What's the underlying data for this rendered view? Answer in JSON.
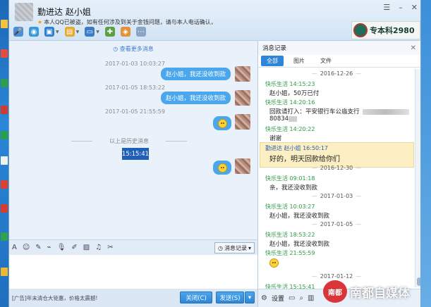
{
  "window": {
    "contact_name": "勤进达 赵小姐",
    "notice": "本人QQ已被盗，如有任何涉及到关于金钱问题，请与本人电话确认，",
    "brand": "专本科2980"
  },
  "chat": {
    "more_messages": "查看更多消息",
    "history_divider": "以上是历史消息",
    "messages": [
      {
        "time": "2017-01-03 10:03:27",
        "text": "赵小姐，我还没收到款"
      },
      {
        "time": "2017-01-05 18:53:22",
        "text": "赵小姐，我还没收到款"
      },
      {
        "time": "2017-01-05 21:55:59",
        "text": ""
      }
    ],
    "current_time": "15:15:41"
  },
  "input": {
    "record_button": "消息记录",
    "ad": "[广告]年末清仓大钜惠，价格太震撼!",
    "close_button": "关闭(C)",
    "send_button": "发送(S)"
  },
  "record": {
    "title": "消息记录",
    "tabs": [
      "全部",
      "图片",
      "文件"
    ],
    "entries": {
      "d1": "2016-12-26",
      "s1": "快乐生活 14:15:23",
      "t1": "赵小姐，50万已付",
      "s2": "快乐生活 14:20:16",
      "t2": "回款请打入：平安银行车公庙支行",
      "t2b": "80834",
      "s3": "快乐生活 14:20:22",
      "t3": "谢谢",
      "s4": "勤进达 赵小姐 16:50:17",
      "t4": "好的，明天回款给你们",
      "d2": "2016-12-30",
      "s5": "快乐生活 09:01:18",
      "t5": "亲，我还没收到款",
      "d3": "2017-01-03",
      "s6": "快乐生活 10:03:27",
      "t6": "赵小姐，我还没收到款",
      "d4": "2017-01-05",
      "s7": "快乐生活 18:53:22",
      "t7": "赵小姐，我还没收到款",
      "s8": "快乐生活 21:55:59",
      "d5": "2017-01-12",
      "s9": "快乐生活 15:15:41"
    },
    "settings_label": "设置",
    "bottom_date": "2016-12-26"
  },
  "watermark": {
    "logo": "南都",
    "text": "南都自媒体"
  },
  "colors": {
    "accent": "#2f85d8",
    "bubble": "#4aa7ee",
    "sender_green": "#2d9a44",
    "highlight": "#fcefc4"
  }
}
